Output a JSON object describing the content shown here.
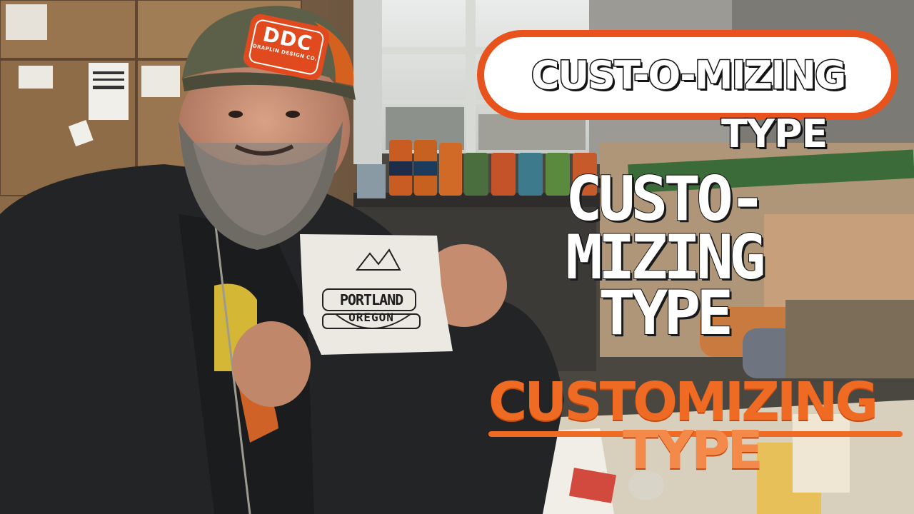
{
  "hat_patch": {
    "logo": "DDC",
    "subtext": "DRAPLIN DESIGN CO."
  },
  "sketch": {
    "line1": "PORTLAND",
    "line2": "OREGON"
  },
  "titles": {
    "title1": {
      "line1": "CUST-O-MIZING",
      "line2": "TYPE"
    },
    "title2": {
      "line1": "CUSTO-",
      "line2": "MIZING",
      "line3": "TYPE"
    },
    "title3": {
      "line1": "CUSTOMIZING",
      "line2": "TYPE"
    }
  },
  "colors": {
    "orange_primary": "#e8531d",
    "orange_light": "#f48a4a",
    "patch_orange": "#e04a1e",
    "hat_green": "#5d6048"
  }
}
